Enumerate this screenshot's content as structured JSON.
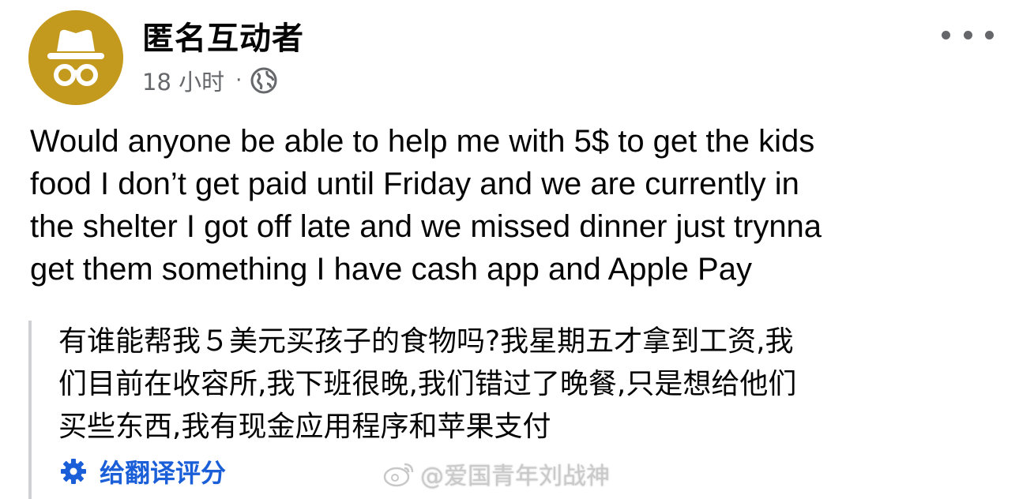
{
  "post": {
    "author": "匿名互动者",
    "time": "18 小时",
    "separator": "·",
    "audience_icon": "globe-icon",
    "more_icon": "more-dots-icon",
    "text": "Would anyone be able to help me with 5$ to get the kids\nfood  I don’t get paid until Friday and we are currently in\nthe shelter I got off late and we missed dinner just trynna\nget them something I have cash app and Apple Pay"
  },
  "translation": {
    "text": "有谁能帮我５美元买孩子的食物吗?我星期五才拿到工资,我\n们目前在收容所,我下班很晚,我们错过了晚餐,只是想给他们\n买些东西,我有现金应用程序和苹果支付",
    "rate_label": "给翻译评分",
    "rate_icon": "gear-icon"
  },
  "watermark": {
    "text": "@爱国青年刘战神"
  },
  "colors": {
    "avatar_bg": "#c39a1e",
    "link": "#1a5ed8",
    "meta": "#65676b"
  }
}
